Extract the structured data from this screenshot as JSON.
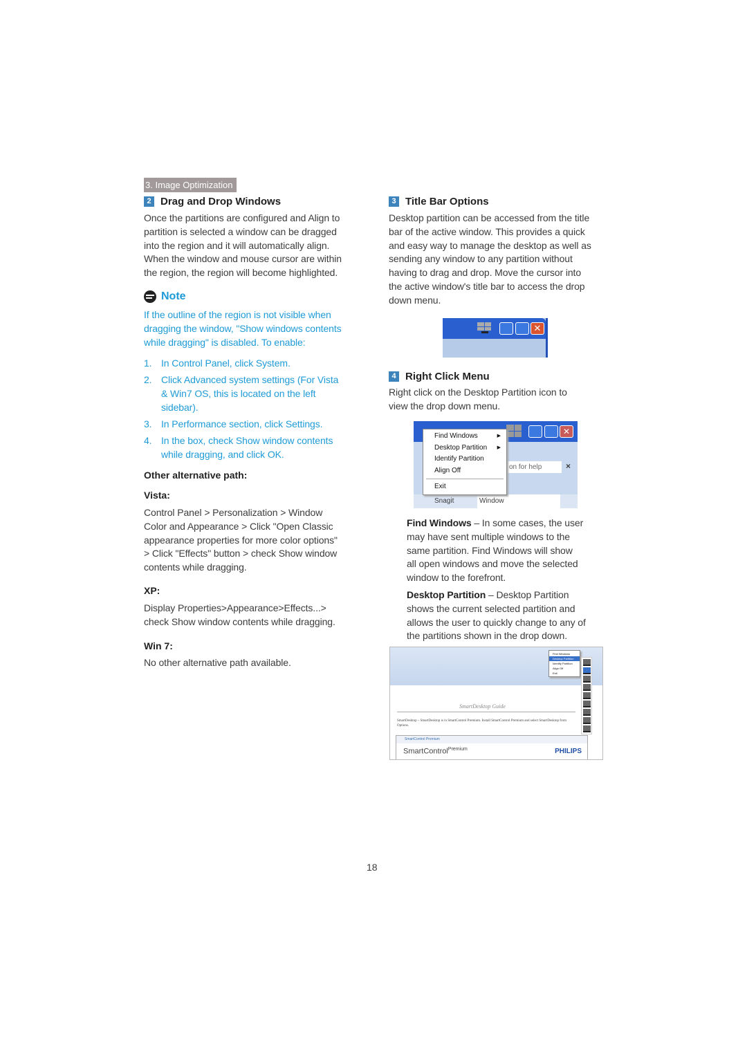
{
  "header": {
    "section": "3. Image Optimization"
  },
  "left": {
    "drag": {
      "num": "2",
      "title": "Drag and Drop Windows",
      "lines": [
        "Once the partitions are configured and Align to",
        "partition is selected a window can be dragged",
        "into the region and it will automatically align.",
        "When the window and mouse cursor are within",
        "the region, the region will become highlighted."
      ]
    },
    "note": {
      "title": "Note",
      "icon": "note-icon",
      "lines": [
        "If the outline of the region is not visible when",
        "dragging the window, \"Show windows contents",
        "while dragging\" is disabled.  To enable:"
      ]
    },
    "steps": [
      {
        "n": "1.",
        "lines": [
          "In Control Panel, click System."
        ]
      },
      {
        "n": "2.",
        "lines": [
          "Click Advanced system settings  (For Vista",
          "& Win7 OS, this is located on the left",
          "sidebar)."
        ]
      },
      {
        "n": "3.",
        "lines": [
          "In Performance section, click Settings."
        ]
      },
      {
        "n": "4.",
        "lines": [
          "In the box, check Show window contents",
          "while dragging, and click OK."
        ]
      }
    ],
    "other": "Other alternative path:",
    "vista": {
      "title": "Vista:",
      "lines": [
        "Control Panel > Personalization > Window",
        "Color and Appearance > Click \"Open Classic",
        "appearance properties for more color options\"",
        "> Click \"Effects\" button > check Show window",
        "contents while dragging."
      ]
    },
    "xp": {
      "title": "XP:",
      "lines": [
        "Display Properties>Appearance>Effects...>",
        "check Show window contents while dragging."
      ]
    },
    "win7": {
      "title": "Win 7:",
      "lines": [
        "No other alternative path available."
      ]
    }
  },
  "right": {
    "title_bar": {
      "num": "3",
      "title": "Title Bar Options",
      "lines": [
        "Desktop partition can be accessed from the title",
        "bar of the active window. This provides a quick",
        "and easy way to manage the desktop as well as",
        "sending any window to any partition without",
        "having to drag and drop.  Move the cursor into",
        "the active window's title bar to access the drop",
        "down menu."
      ]
    },
    "right_click": {
      "num": "4",
      "title": "Right Click Menu",
      "lines": [
        "Right click on the Desktop Partition icon to",
        "view the drop down menu."
      ]
    },
    "menu": {
      "items": [
        "Find Windows",
        "Desktop Partition",
        "Identify Partition",
        "Align Off",
        "Exit"
      ],
      "help_text": "on for help",
      "snagit": "Snagit",
      "window": "Window"
    },
    "find": {
      "term": "Find Windows",
      "lines": [
        " – In some cases, the user",
        "may have sent multiple windows to the",
        "same partition.  Find Windows will show",
        "all open windows and move the selected",
        "window to the forefront."
      ]
    },
    "partition": {
      "term": "Desktop Partition",
      "lines": [
        " – Desktop Partition",
        "shows the current selected partition and",
        "allows the user to quickly change to any of",
        "the partitions shown in the drop down."
      ]
    },
    "screenshot": {
      "doc_title": "SmartDesktop Guide",
      "body": "SmartDesktop – SmartDesktop is in SmartControl Premium.  Install SmartControl Premium and select SmartDesktop from Options.",
      "app_bar": "SmartControl Premium",
      "brand_main": "SmartControl",
      "brand_sup": "Premium",
      "logo": "PHILIPS",
      "menu": [
        "Find Windows",
        "Desktop Partition",
        "Identify Partition",
        "Align Off",
        "Exit"
      ]
    }
  },
  "footer": {
    "page": "18"
  }
}
